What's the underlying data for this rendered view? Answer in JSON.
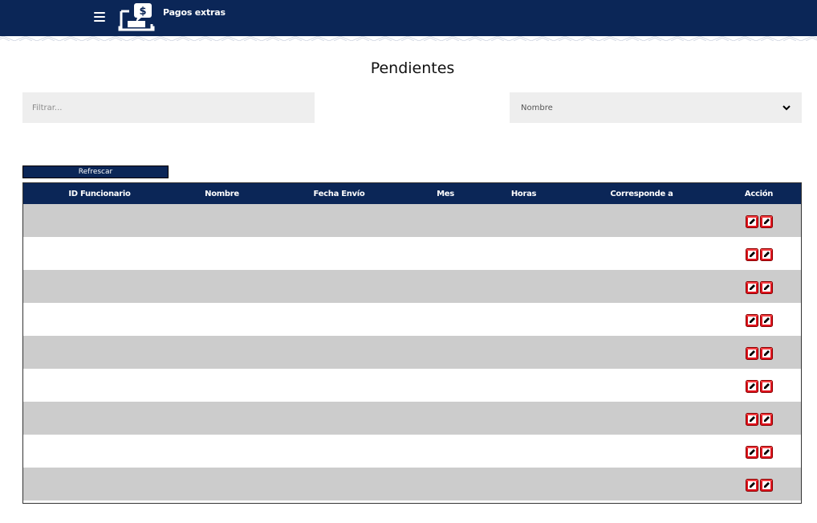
{
  "header": {
    "app_title": "Pagos extras",
    "menu_icon": "hamburger-menu-icon",
    "logo_icon": "laptop-dollar-icon",
    "color": "#0b2657"
  },
  "page": {
    "title": "Pendientes"
  },
  "filter": {
    "placeholder": "Filtrar...",
    "value": ""
  },
  "select": {
    "value": "Nombre",
    "icon": "chevron-down-icon"
  },
  "refresh": {
    "label": "Refrescar"
  },
  "table": {
    "columns": [
      "ID Funcionario",
      "Nombre",
      "Fecha Envío",
      "Mes",
      "Horas",
      "Corresponde a",
      "Acción"
    ],
    "rows": [
      {
        "id": "",
        "nombre": "",
        "fecha": "",
        "mes": "",
        "horas": "",
        "corresponde": ""
      },
      {
        "id": "",
        "nombre": "",
        "fecha": "",
        "mes": "",
        "horas": "",
        "corresponde": ""
      },
      {
        "id": "",
        "nombre": "",
        "fecha": "",
        "mes": "",
        "horas": "",
        "corresponde": ""
      },
      {
        "id": "",
        "nombre": "",
        "fecha": "",
        "mes": "",
        "horas": "",
        "corresponde": ""
      },
      {
        "id": "",
        "nombre": "",
        "fecha": "",
        "mes": "",
        "horas": "",
        "corresponde": ""
      },
      {
        "id": "",
        "nombre": "",
        "fecha": "",
        "mes": "",
        "horas": "",
        "corresponde": ""
      },
      {
        "id": "",
        "nombre": "",
        "fecha": "",
        "mes": "",
        "horas": "",
        "corresponde": ""
      },
      {
        "id": "",
        "nombre": "",
        "fecha": "",
        "mes": "",
        "horas": "",
        "corresponde": ""
      },
      {
        "id": "",
        "nombre": "",
        "fecha": "",
        "mes": "",
        "horas": "",
        "corresponde": ""
      }
    ],
    "action_icons": [
      "edit-icon",
      "edit-icon"
    ],
    "action_color": "#e0141e",
    "stripe_color": "#cccccc"
  }
}
